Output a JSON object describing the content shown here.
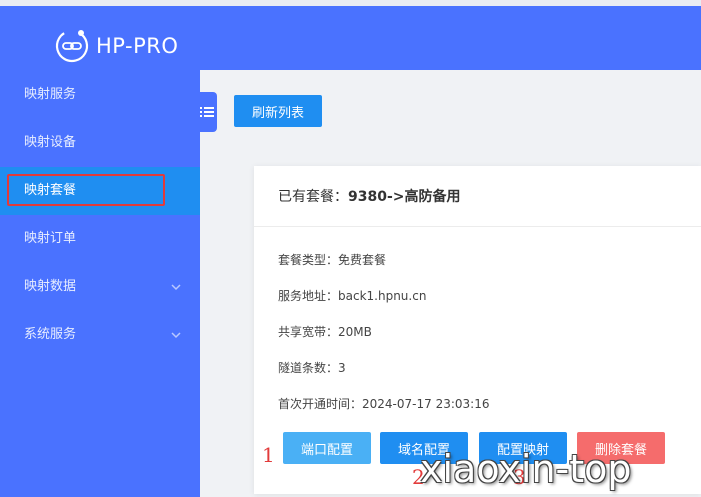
{
  "app": {
    "logo_text": "HP-PRO"
  },
  "sidebar": {
    "items": [
      {
        "label": "映射服务",
        "has_chevron": false
      },
      {
        "label": "映射设备",
        "has_chevron": false
      },
      {
        "label": "映射套餐",
        "has_chevron": false,
        "active": true
      },
      {
        "label": "映射订单",
        "has_chevron": false
      },
      {
        "label": "映射数据",
        "has_chevron": true
      },
      {
        "label": "系统服务",
        "has_chevron": true
      }
    ]
  },
  "toolbar": {
    "refresh_label": "刷新列表"
  },
  "package": {
    "title_prefix": "已有套餐：",
    "title_value": "9380->高防备用",
    "rows": [
      {
        "label": "套餐类型：",
        "value": "免费套餐"
      },
      {
        "label": "服务地址：",
        "value": "back1.hpnu.cn"
      },
      {
        "label": "共享宽带：",
        "value": "20MB"
      },
      {
        "label": "隧道条数：",
        "value": "3"
      },
      {
        "label": "首次开通时间：",
        "value": "2024-07-17 23:03:16"
      }
    ],
    "buttons": {
      "port": "端口配置",
      "domain": "域名配置",
      "mapping": "配置映射",
      "delete": "删除套餐"
    }
  },
  "annotations": {
    "one": "1",
    "two": "2",
    "three": "3"
  },
  "watermark": "xiaoxin-top",
  "colors": {
    "sidebar": "#4a72ff",
    "active": "#1f8ef1",
    "primary": "#1f8ef1",
    "danger": "#f56c6c",
    "annotation": "#e23b3b"
  }
}
